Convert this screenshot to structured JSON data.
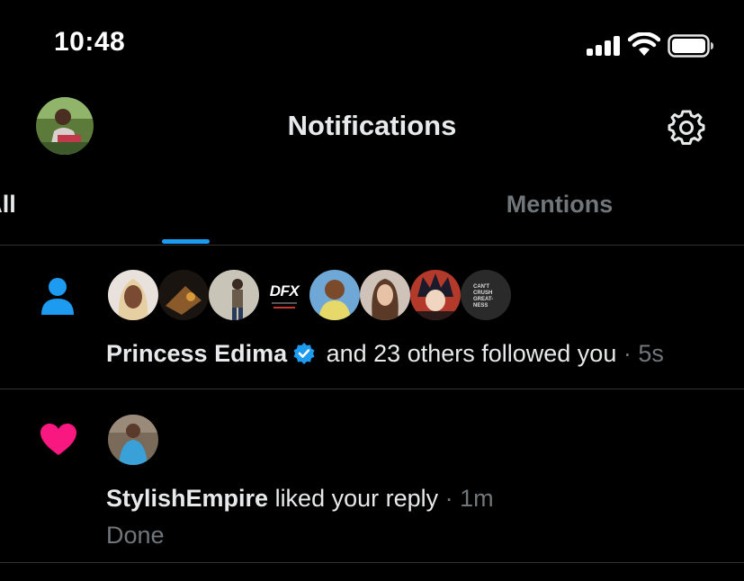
{
  "status_bar": {
    "time": "10:48",
    "signal_icon": "signal-bars-icon",
    "wifi_icon": "wifi-icon",
    "battery_icon": "battery-icon"
  },
  "header": {
    "title": "Notifications",
    "settings_icon": "gear-icon"
  },
  "tabs": [
    {
      "label": "All",
      "active": true
    },
    {
      "label": "Mentions",
      "active": false
    }
  ],
  "colors": {
    "accent": "#1d9bf0",
    "like": "#f91880",
    "muted": "#71767b",
    "divider": "#2f3336"
  },
  "notifications": [
    {
      "type": "follow",
      "icon": "person-icon",
      "actor": "Princess Edima",
      "verified": true,
      "rest": " and 23 others followed you",
      "time": " · 5s",
      "avatars": [
        {
          "label": ""
        },
        {
          "label": ""
        },
        {
          "label": ""
        },
        {
          "label": "DFX"
        },
        {
          "label": ""
        },
        {
          "label": ""
        },
        {
          "label": ""
        },
        {
          "label": "CAN'T CRUSH GREATNESS"
        }
      ]
    },
    {
      "type": "like",
      "icon": "heart-icon",
      "actor": "StylishEmpire",
      "rest": " liked your reply",
      "time": " · 1m",
      "subtext": "Done"
    }
  ]
}
